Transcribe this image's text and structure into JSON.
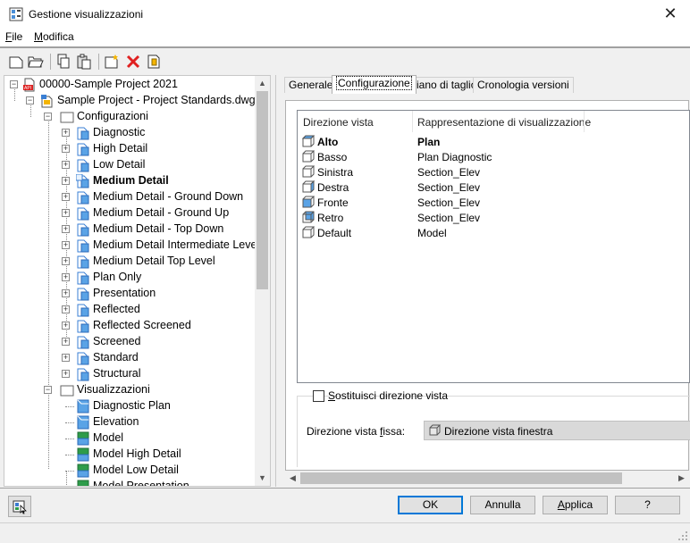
{
  "window": {
    "title": "Gestione visualizzazioni",
    "close_glyph": "✕"
  },
  "menu": [
    {
      "key": "F",
      "rest": "ile"
    },
    {
      "key": "M",
      "rest": "odifica"
    }
  ],
  "toolbar": [
    "new-icon",
    "open-icon",
    "copy-icon",
    "paste-icon",
    "add-icon",
    "delete-icon",
    "purge-icon"
  ],
  "tree": {
    "items": [
      {
        "label": "00000-Sample Project 2021",
        "icon": "project-api-icon",
        "level": 0
      },
      {
        "label": "Sample Project - Project Standards.dwg",
        "icon": "drawing-icon",
        "level": 1
      },
      {
        "label": "Configurazioni",
        "icon": "folder-icon",
        "level": 2
      },
      {
        "label": "Diagnostic",
        "icon": "config-icon",
        "level": 3
      },
      {
        "label": "High Detail",
        "icon": "config-icon",
        "level": 3
      },
      {
        "label": "Low Detail",
        "icon": "config-icon",
        "level": 3
      },
      {
        "label": "Medium Detail",
        "icon": "config-active-icon",
        "level": 3,
        "bold": true
      },
      {
        "label": "Medium Detail - Ground Down",
        "icon": "config-icon",
        "level": 3
      },
      {
        "label": "Medium Detail - Ground Up",
        "icon": "config-icon",
        "level": 3
      },
      {
        "label": "Medium Detail - Top Down",
        "icon": "config-icon",
        "level": 3
      },
      {
        "label": "Medium Detail Intermediate Level",
        "icon": "config-icon",
        "level": 3
      },
      {
        "label": "Medium Detail Top Level",
        "icon": "config-icon",
        "level": 3
      },
      {
        "label": "Plan Only",
        "icon": "config-icon",
        "level": 3
      },
      {
        "label": "Presentation",
        "icon": "config-icon",
        "level": 3
      },
      {
        "label": "Reflected",
        "icon": "config-icon",
        "level": 3
      },
      {
        "label": "Reflected Screened",
        "icon": "config-icon",
        "level": 3
      },
      {
        "label": "Screened",
        "icon": "config-icon",
        "level": 3
      },
      {
        "label": "Standard",
        "icon": "config-icon",
        "level": 3
      },
      {
        "label": "Structural",
        "icon": "config-icon",
        "level": 3
      },
      {
        "label": "Visualizzazioni",
        "icon": "folder-icon",
        "level": 2
      },
      {
        "label": "Diagnostic Plan",
        "icon": "display-rep-icon",
        "level": 3,
        "leaf": true
      },
      {
        "label": "Elevation",
        "icon": "display-rep-icon",
        "level": 3,
        "leaf": true
      },
      {
        "label": "Model",
        "icon": "display-rep-green-icon",
        "level": 3,
        "leaf": true
      },
      {
        "label": "Model High Detail",
        "icon": "display-rep-green-icon",
        "level": 3,
        "leaf": true
      },
      {
        "label": "Model Low Detail",
        "icon": "display-rep-green-icon",
        "level": 3,
        "leaf": true
      },
      {
        "label": "Model Presentation",
        "icon": "display-rep-green-icon",
        "level": 3,
        "leaf": true
      }
    ]
  },
  "tabs": [
    {
      "label": "Generale",
      "active": false
    },
    {
      "label": "Configurazione",
      "active": true
    },
    {
      "label": "Piano di taglio",
      "active": false
    },
    {
      "label": "Cronologia versioni",
      "active": false
    }
  ],
  "list": {
    "columns": [
      "Direzione vista",
      "Rappresentazione di visualizzazione"
    ],
    "rows": [
      {
        "dir": "Alto",
        "rep": "Plan",
        "bold": true,
        "icon": "view-top-icon"
      },
      {
        "dir": "Basso",
        "rep": "Plan Diagnostic",
        "icon": "view-bottom-icon"
      },
      {
        "dir": "Sinistra",
        "rep": "Section_Elev",
        "icon": "view-left-icon"
      },
      {
        "dir": "Destra",
        "rep": "Section_Elev",
        "icon": "view-right-icon"
      },
      {
        "dir": "Fronte",
        "rep": "Section_Elev",
        "icon": "view-front-icon"
      },
      {
        "dir": "Retro",
        "rep": "Section_Elev",
        "icon": "view-back-icon"
      },
      {
        "dir": "Default",
        "rep": "Model",
        "icon": "view-default-icon"
      }
    ]
  },
  "override": {
    "checkbox_key": "S",
    "checkbox_rest": "ostituisci direzione vista",
    "checked": false,
    "fixed_label_pre": "Direzione vista ",
    "fixed_label_key": "f",
    "fixed_label_post": "issa:",
    "fixed_value": "Direzione vista finestra"
  },
  "buttons": {
    "ok": "OK",
    "cancel": "Annulla",
    "apply_key": "A",
    "apply_rest": "pplica",
    "help": "?"
  },
  "colors": {
    "accent": "#0078d7",
    "icon_blue": "#5aa3e6",
    "delete_red": "#e02020"
  }
}
